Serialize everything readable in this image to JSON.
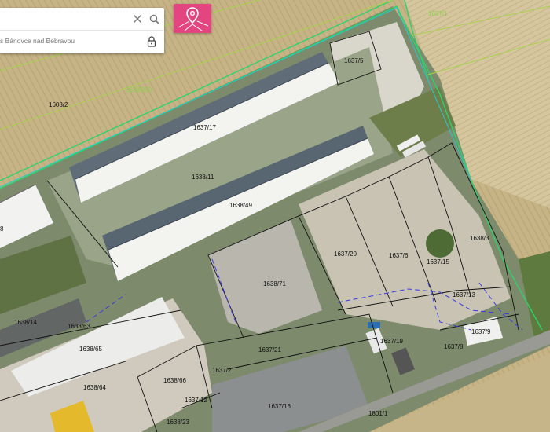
{
  "search": {
    "query": "",
    "result_text": "s Bánovce nad Bebravou"
  },
  "icons": {
    "clear": "close-icon",
    "search": "search-icon",
    "lock": "lock-icon",
    "map_pin": "map-pin-icon"
  },
  "colors": {
    "pin_button": "#e2457f",
    "parcel_border": "#111111",
    "cadastre_green": "#2bd36b",
    "plan_line": "#3a3adf"
  },
  "parcels": {
    "p1608_2": "1608/2",
    "p1638_200": "1638/200",
    "p1637_1": "1637/1",
    "p1637_5": "1637/5",
    "p1637_17": "1637/17",
    "p1638_11": "1638/11",
    "p1638_49": "1638/49",
    "p1637_20": "1637/20",
    "p1637_6": "1637/6",
    "p1637_15": "1637/15",
    "p1638_3": "1638/3",
    "p1638_71": "1638/71",
    "p1637_13": "1637/13",
    "p1637_9": "1637/9",
    "p1637_19": "1637/19",
    "p1637_8": "1637/8",
    "p1638_14": "1638/14",
    "p1638_63": "1638/63",
    "p1638_65": "1638/65",
    "p1638_64": "1638/64",
    "p1638_66": "1638/66",
    "p1637_2": "1637/2",
    "p1637_21": "1637/21",
    "p1637_12": "1637/12",
    "p1637_16": "1637/16",
    "p1801_1": "1801/1",
    "p1638_23": "1638/23",
    "p8": "8"
  }
}
